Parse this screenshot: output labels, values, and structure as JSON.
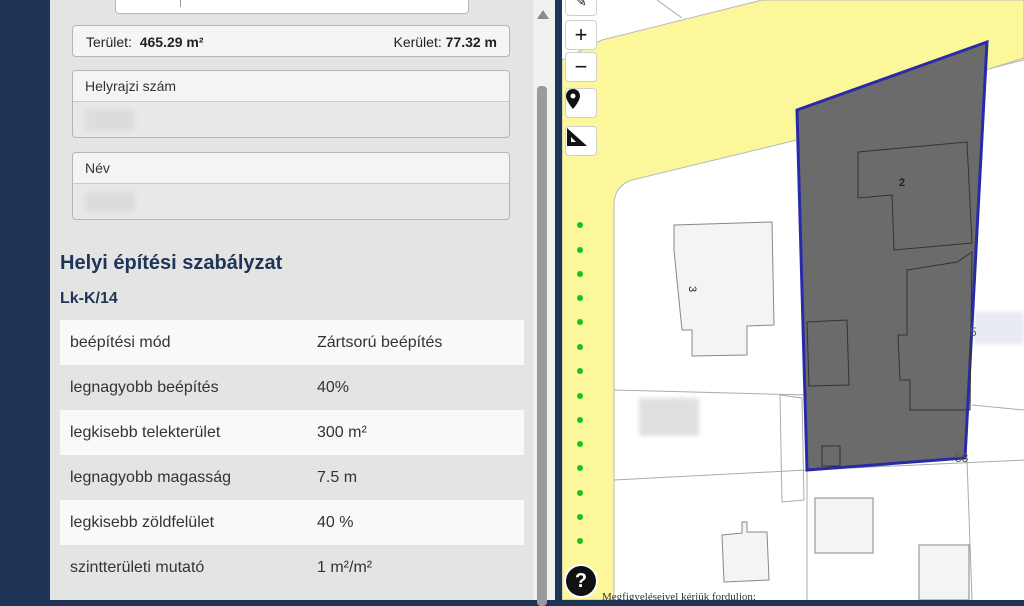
{
  "area": {
    "area_label": "Terület:",
    "area_value": "465.29  m²",
    "perimeter_label": "Kerület:",
    "perimeter_value": "77.32 m"
  },
  "fields": {
    "parcel_label": "Helyrajzi szám",
    "parcel_value": "",
    "name_label": "Név",
    "name_value": ""
  },
  "regulation": {
    "title": "Helyi építési szabályzat",
    "zone": "Lk-K/14",
    "rows": [
      {
        "key": "beépítési mód",
        "value": "Zártsorú beépítés"
      },
      {
        "key": "legnagyobb beépítés",
        "value": "40%"
      },
      {
        "key": "legkisebb telekterület",
        "value": "300 m²"
      },
      {
        "key": "legnagyobb magasság",
        "value": "7.5 m"
      },
      {
        "key": "legkisebb zöldfelület",
        "value": "40 %"
      },
      {
        "key": "szintterületi mutató",
        "value": "1 m²/m²"
      }
    ]
  },
  "map": {
    "zoom_in": "+",
    "zoom_out": "−",
    "help": "?",
    "label_building_2": "2",
    "label_building_3": "3",
    "label_5": "5",
    "label_53": "53",
    "colors": {
      "road": "#fbf79a",
      "selection_fill": "#6b6b6b",
      "selection_stroke": "#2a2aa8",
      "green_dots": "#19c419"
    },
    "attribution_text": "Megfigyeléseivel kérjük forduljon:",
    "attribution_email": ""
  }
}
